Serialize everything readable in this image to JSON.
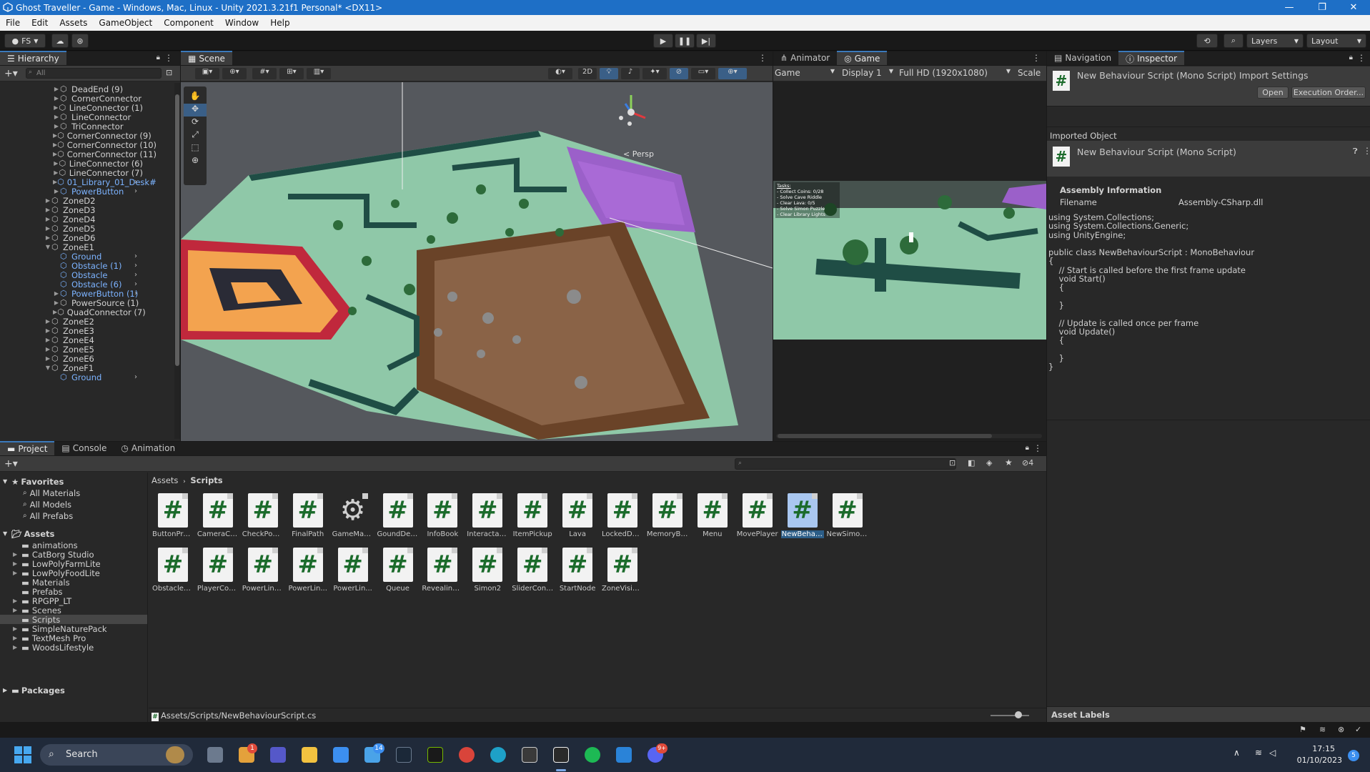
{
  "window": {
    "title": "Ghost Traveller - Game - Windows, Mac, Linux - Unity 2021.3.21f1 Personal* <DX11>"
  },
  "menu": [
    "File",
    "Edit",
    "Assets",
    "GameObject",
    "Component",
    "Window",
    "Help"
  ],
  "toolbar": {
    "account": "FS",
    "layers": "Layers",
    "layout": "Layout"
  },
  "hierarchy": {
    "tab": "Hierarchy",
    "search_placeholder": "All",
    "items": [
      {
        "label": "DeadEnd (9)",
        "indent": 2,
        "prefab": false,
        "arrow": true
      },
      {
        "label": "CornerConnector",
        "indent": 2,
        "prefab": false,
        "arrow": true
      },
      {
        "label": "LineConnector (1)",
        "indent": 2,
        "prefab": false,
        "arrow": true
      },
      {
        "label": "LineConnector",
        "indent": 2,
        "prefab": false,
        "arrow": true
      },
      {
        "label": "TriConnector",
        "indent": 2,
        "prefab": false,
        "arrow": true
      },
      {
        "label": "CornerConnector (9)",
        "indent": 2,
        "prefab": false,
        "arrow": true
      },
      {
        "label": "CornerConnector (10)",
        "indent": 2,
        "prefab": false,
        "arrow": true
      },
      {
        "label": "CornerConnector (11)",
        "indent": 2,
        "prefab": false,
        "arrow": true
      },
      {
        "label": "LineConnector (6)",
        "indent": 2,
        "prefab": false,
        "arrow": true
      },
      {
        "label": "LineConnector (7)",
        "indent": 2,
        "prefab": false,
        "arrow": true
      },
      {
        "label": "01_Library_01_Desk#",
        "indent": 2,
        "prefab": true,
        "arrow": true
      },
      {
        "label": "PowerButton",
        "indent": 2,
        "prefab": true,
        "arrow": true
      },
      {
        "label": "ZoneD2",
        "indent": 1,
        "prefab": false,
        "arrow": true
      },
      {
        "label": "ZoneD3",
        "indent": 1,
        "prefab": false,
        "arrow": true
      },
      {
        "label": "ZoneD4",
        "indent": 1,
        "prefab": false,
        "arrow": true
      },
      {
        "label": "ZoneD5",
        "indent": 1,
        "prefab": false,
        "arrow": true
      },
      {
        "label": "ZoneD6",
        "indent": 1,
        "prefab": false,
        "arrow": true
      },
      {
        "label": "ZoneE1",
        "indent": 1,
        "prefab": false,
        "arrow": true,
        "open": true
      },
      {
        "label": "Ground",
        "indent": 2,
        "prefab": true,
        "arrow": false
      },
      {
        "label": "Obstacle (1)",
        "indent": 2,
        "prefab": true,
        "arrow": false
      },
      {
        "label": "Obstacle",
        "indent": 2,
        "prefab": true,
        "arrow": false
      },
      {
        "label": "Obstacle (6)",
        "indent": 2,
        "prefab": true,
        "arrow": false
      },
      {
        "label": "PowerButton (1)",
        "indent": 2,
        "prefab": true,
        "arrow": true
      },
      {
        "label": "PowerSource (1)",
        "indent": 2,
        "prefab": false,
        "arrow": true
      },
      {
        "label": "QuadConnector (7)",
        "indent": 2,
        "prefab": false,
        "arrow": true
      },
      {
        "label": "ZoneE2",
        "indent": 1,
        "prefab": false,
        "arrow": true
      },
      {
        "label": "ZoneE3",
        "indent": 1,
        "prefab": false,
        "arrow": true
      },
      {
        "label": "ZoneE4",
        "indent": 1,
        "prefab": false,
        "arrow": true
      },
      {
        "label": "ZoneE5",
        "indent": 1,
        "prefab": false,
        "arrow": true
      },
      {
        "label": "ZoneE6",
        "indent": 1,
        "prefab": false,
        "arrow": true
      },
      {
        "label": "ZoneF1",
        "indent": 1,
        "prefab": false,
        "arrow": true,
        "open": true
      },
      {
        "label": "Ground",
        "indent": 2,
        "prefab": true,
        "arrow": false
      }
    ]
  },
  "scene": {
    "tab": "Scene",
    "mode_2d": "2D",
    "persp": "Persp"
  },
  "game": {
    "tabs": [
      "Animator",
      "Game"
    ],
    "view_mode": "Game",
    "display": "Display 1",
    "resolution": "Full HD (1920x1080)",
    "scale": "Scale",
    "hud_title": "Tasks:",
    "hud_lines": [
      "- Collect Coins: 0/28",
      "- Solve Cave Riddle",
      "- Clear Lava: 0/5",
      "- Solve Simon Puzzle",
      "- Clear Library Lights"
    ]
  },
  "inspector": {
    "tabs": [
      "Navigation",
      "Inspector"
    ],
    "header_title": "New Behaviour Script (Mono Script) Import Settings",
    "open_btn": "Open",
    "exec_btn": "Execution Order...",
    "imported_label": "Imported Object",
    "object_title": "New Behaviour Script (Mono Script)",
    "assembly_header": "Assembly Information",
    "filename_label": "Filename",
    "filename_value": "Assembly-CSharp.dll",
    "code": [
      "using System.Collections;",
      "using System.Collections.Generic;",
      "using UnityEngine;",
      "",
      "public class NewBehaviourScript : MonoBehaviour",
      "{",
      "    // Start is called before the first frame update",
      "    void Start()",
      "    {",
      "",
      "    }",
      "",
      "    // Update is called once per frame",
      "    void Update()",
      "    {",
      "",
      "    }",
      "}"
    ],
    "asset_labels": "Asset Labels"
  },
  "project": {
    "tabs": [
      "Project",
      "Console",
      "Animation"
    ],
    "hidden_count": "4",
    "breadcrumb": [
      "Assets",
      "Scripts"
    ],
    "favorites": {
      "label": "Favorites",
      "items": [
        "All Materials",
        "All Models",
        "All Prefabs"
      ]
    },
    "assets_root": "Assets",
    "folders": [
      {
        "label": "animations",
        "arrow": false
      },
      {
        "label": "CatBorg Studio",
        "arrow": true
      },
      {
        "label": "LowPolyFarmLite",
        "arrow": true
      },
      {
        "label": "LowPolyFoodLite",
        "arrow": true
      },
      {
        "label": "Materials",
        "arrow": false
      },
      {
        "label": "Prefabs",
        "arrow": false
      },
      {
        "label": "RPGPP_LT",
        "arrow": true
      },
      {
        "label": "Scenes",
        "arrow": true
      },
      {
        "label": "Scripts",
        "arrow": false,
        "selected": true
      },
      {
        "label": "SimpleNaturePack",
        "arrow": true
      },
      {
        "label": "TextMesh Pro",
        "arrow": true
      },
      {
        "label": "WoodsLifestyle",
        "arrow": true
      }
    ],
    "packages": "Packages",
    "assets_row1": [
      "ButtonPre...",
      "CameraCo...",
      "CheckPow...",
      "FinalPath",
      "GameMan...",
      "GoundDet...",
      "InfoBook",
      "Interactab...",
      "ItemPickup",
      "Lava",
      "LockedDoor",
      "MemoryBu...",
      "Menu",
      "MovePlayer",
      "NewBehav...",
      "NewSimon..."
    ],
    "assets_row2": [
      "ObstacleVi...",
      "PlayerCont...",
      "PowerLine...",
      "PowerLin...",
      "PowerLin...",
      "Queue",
      "RevealingP...",
      "Simon2",
      "SliderCont...",
      "StartNode",
      "ZoneVisibili..."
    ],
    "selected_asset": "NewBehav...",
    "gear_asset": "GameMan...",
    "path": "Assets/Scripts/NewBehaviourScript.cs"
  },
  "taskbar": {
    "search": "Search",
    "time": "17:15",
    "date": "01/10/2023",
    "badge_mail": "14",
    "badge_teams": "1",
    "badge_discord": "9+",
    "notif": "5"
  },
  "colors": {
    "accent": "#3a79bb",
    "titlebar": "#1e6fc6",
    "script_green": "#1b6b2b"
  }
}
